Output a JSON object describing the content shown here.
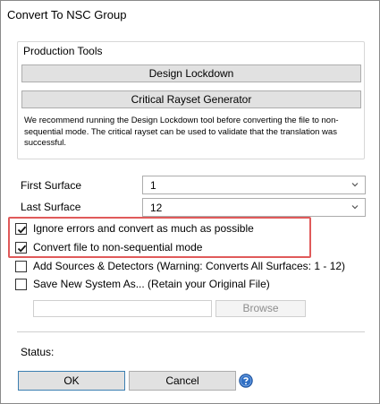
{
  "window": {
    "title": "Convert To NSC Group"
  },
  "production_tools": {
    "legend": "Production Tools",
    "design_lockdown_label": "Design Lockdown",
    "rayset_label": "Critical Rayset Generator",
    "note": "We recommend running the Design Lockdown tool before converting the file to non-sequential mode. The critical rayset can be used to validate that the translation was successful."
  },
  "first_surface": {
    "label": "First Surface",
    "value": "1"
  },
  "last_surface": {
    "label": "Last Surface",
    "value": "12"
  },
  "options": {
    "ignore_errors": {
      "label": "Ignore errors and convert as much as possible",
      "checked": true
    },
    "convert_nsc": {
      "label": "Convert file to non-sequential mode",
      "checked": true
    },
    "add_sources": {
      "label": "Add Sources & Detectors (Warning: Converts All Surfaces: 1 - 12)",
      "checked": false
    },
    "save_new": {
      "label": "Save New System As... (Retain your Original File)",
      "checked": false
    }
  },
  "save_path": {
    "value": ""
  },
  "browse_label": "Browse",
  "status": {
    "label": "Status:"
  },
  "buttons": {
    "ok": "OK",
    "cancel": "Cancel"
  },
  "icons": {
    "checkmark": "checkmark-icon",
    "dropdown": "chevron-down-icon",
    "help": "help-icon"
  },
  "colors": {
    "highlight": "#e05a5a",
    "help_blue": "#2f6fc4",
    "button_bg": "#e1e1e1"
  }
}
